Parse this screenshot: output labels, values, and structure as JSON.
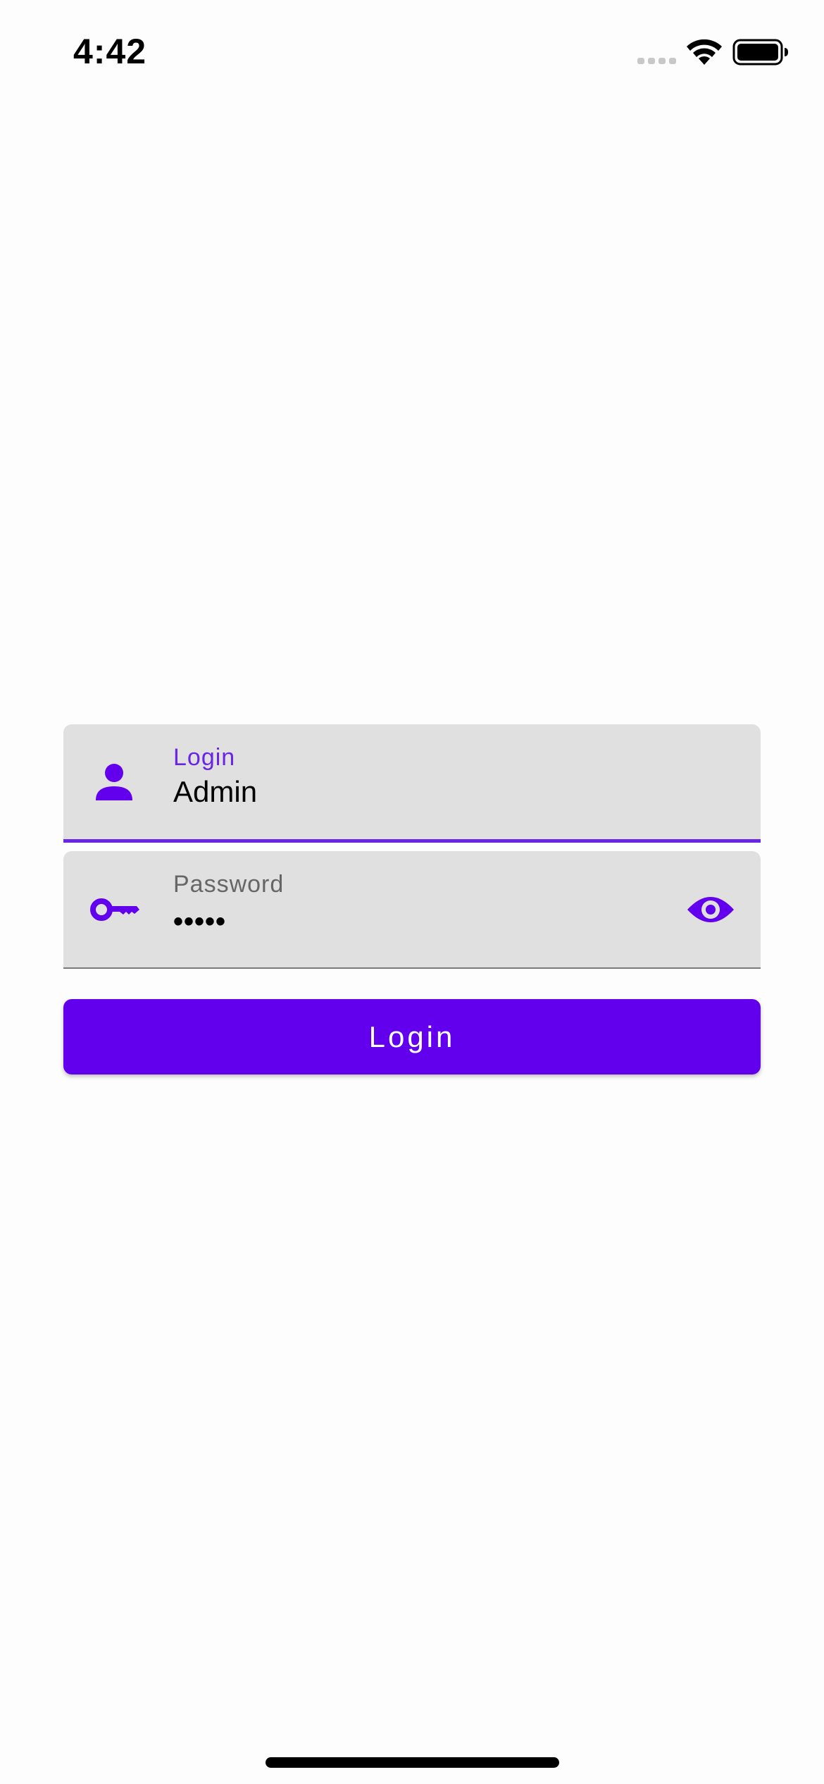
{
  "status_bar": {
    "time": "4:42",
    "icons": [
      "cellular-signal-icon",
      "wifi-icon",
      "battery-icon"
    ]
  },
  "form": {
    "login_field": {
      "label": "Login",
      "value": "Admin",
      "icon": "person-icon"
    },
    "password_field": {
      "label": "Password",
      "value": "•••••",
      "icon": "key-icon",
      "toggle_icon": "eye-icon"
    },
    "login_button_label": "Login"
  },
  "colors": {
    "accent": "#6200ee",
    "field_background": "#e0e0e0",
    "label_focused": "#6a24e6",
    "label_unfocused": "#666666"
  }
}
